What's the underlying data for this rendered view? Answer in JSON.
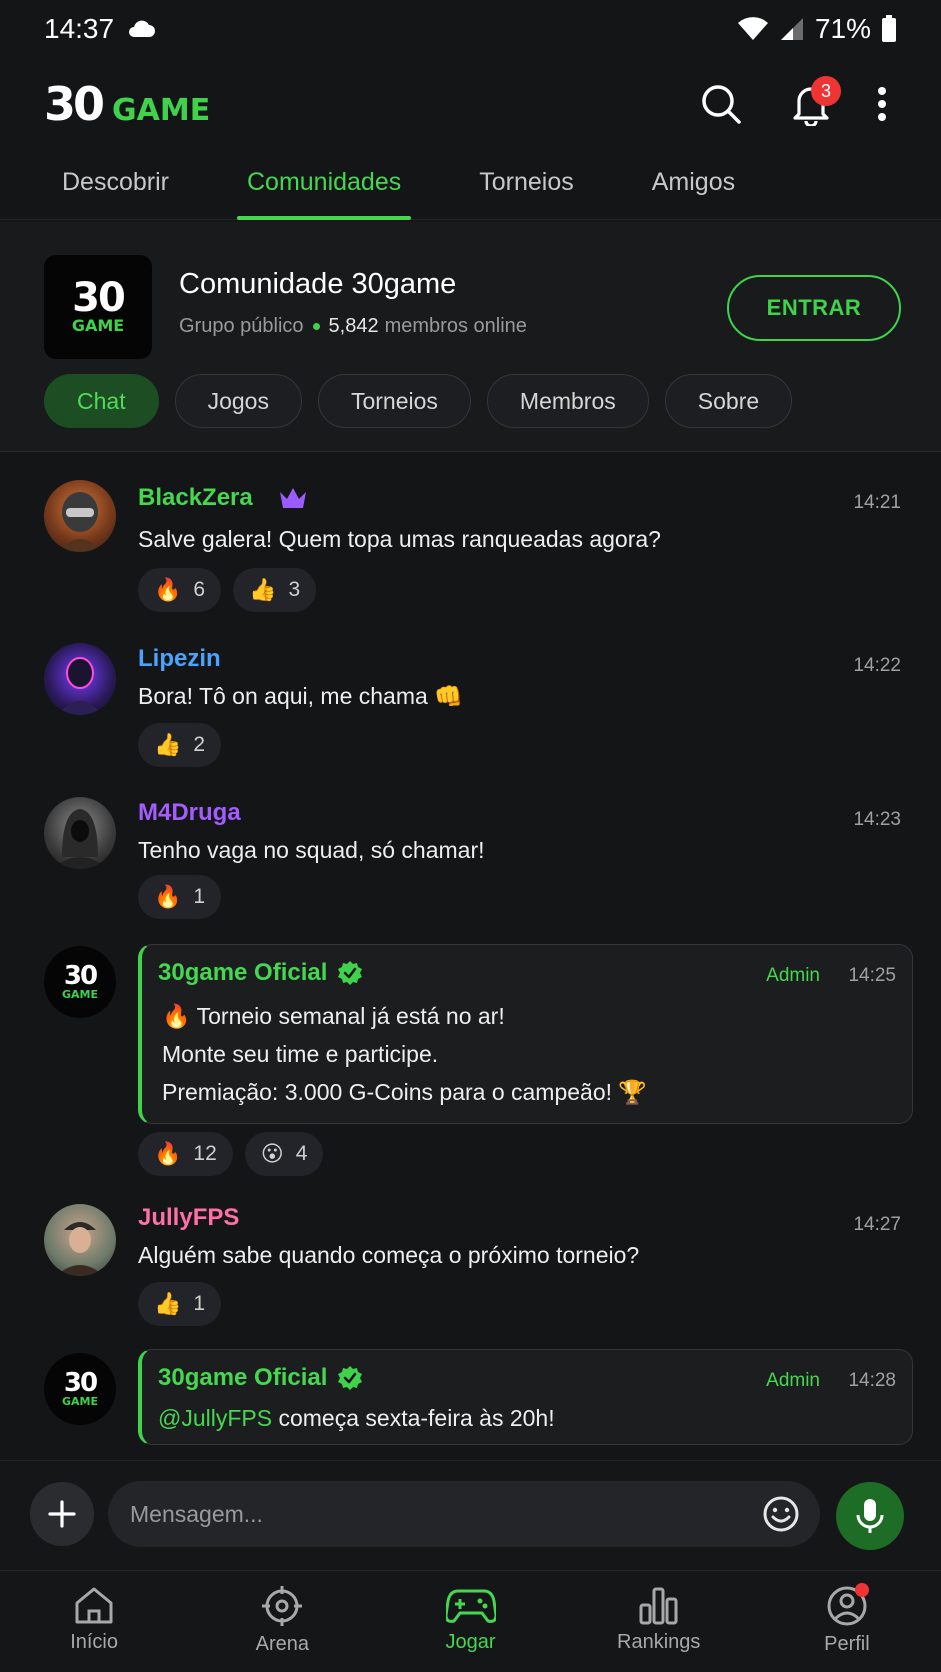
{
  "status": {
    "time": "14:37",
    "battery": "71%"
  },
  "header": {
    "logo_number": "30",
    "logo_word": "GAME",
    "notification_count": "3"
  },
  "tabs": [
    {
      "label": "Descobrir"
    },
    {
      "label": "Comunidades"
    },
    {
      "label": "Torneios"
    },
    {
      "label": "Amigos"
    }
  ],
  "community": {
    "logo_number": "30",
    "logo_word": "GAME",
    "name": "Comunidade 30game",
    "type": "Grupo público",
    "online_count": "5,842",
    "online_label": "membros online",
    "join_label": "ENTRAR",
    "pills": [
      {
        "label": "Chat"
      },
      {
        "label": "Jogos"
      },
      {
        "label": "Torneios"
      },
      {
        "label": "Membros"
      },
      {
        "label": "Sobre"
      }
    ]
  },
  "messages": [
    {
      "user": "BlackZera",
      "color": "#46d750",
      "time": "14:21",
      "text": "Salve galera! Quem topa umas ranqueadas agora?",
      "reactions": [
        {
          "emoji": "🔥",
          "count": "6"
        },
        {
          "emoji": "👍",
          "count": "3"
        }
      ]
    },
    {
      "user": "Lipezin",
      "color": "#4aa3ff",
      "time": "14:22",
      "text": "Bora! Tô on aqui, me chama 👊",
      "reactions": [
        {
          "emoji": "👍",
          "count": "2"
        }
      ]
    },
    {
      "user": "M4Druga",
      "color": "#a35dff",
      "time": "14:23",
      "text": "Tenho vaga no squad, só chamar!",
      "reactions": [
        {
          "emoji": "🔥",
          "count": "1"
        }
      ]
    },
    {
      "user": "30game Oficial",
      "role": "Admin",
      "time": "14:25",
      "lines": [
        "🔥 Torneio semanal já está no ar!",
        "Monte seu time e participe.",
        "Premiação: 3.000 G-Coins para o campeão! 🏆"
      ],
      "reactions": [
        {
          "emoji": "🔥",
          "count": "12"
        },
        {
          "emoji": "😮",
          "count": "4"
        }
      ]
    },
    {
      "user": "JullyFPS",
      "color": "#ff6fa8",
      "time": "14:27",
      "text": "Alguém sabe quando começa o próximo torneio?",
      "reactions": [
        {
          "emoji": "👍",
          "count": "1"
        }
      ]
    },
    {
      "user": "30game Oficial",
      "role": "Admin",
      "time": "14:28",
      "mention": "@JullyFPS",
      "text": " começa sexta-feira às 20h!"
    }
  ],
  "composer": {
    "placeholder": "Mensagem..."
  },
  "nav": [
    {
      "label": "Início"
    },
    {
      "label": "Arena"
    },
    {
      "label": "Jogar"
    },
    {
      "label": "Rankings"
    },
    {
      "label": "Perfil"
    }
  ]
}
